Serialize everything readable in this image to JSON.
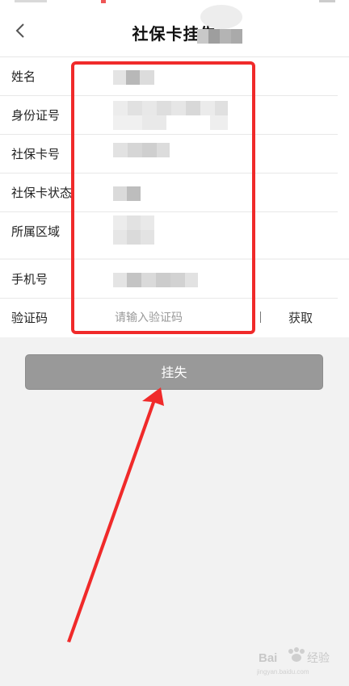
{
  "nav": {
    "title": "社保卡挂失"
  },
  "form": {
    "fields": [
      {
        "label": "姓名"
      },
      {
        "label": "身份证号"
      },
      {
        "label": "社保卡号"
      },
      {
        "label": "社保卡状态"
      },
      {
        "label": "所属区域"
      }
    ],
    "phone": {
      "label": "手机号"
    },
    "code": {
      "label": "验证码",
      "placeholder": "请输入验证码",
      "get_label": "获取"
    }
  },
  "submit": {
    "label": "挂失"
  },
  "colors": {
    "highlight": "#f02a2a",
    "button": "#999999",
    "background": "#f2f2f2"
  },
  "icons": {
    "back": "chevron-left-icon"
  }
}
